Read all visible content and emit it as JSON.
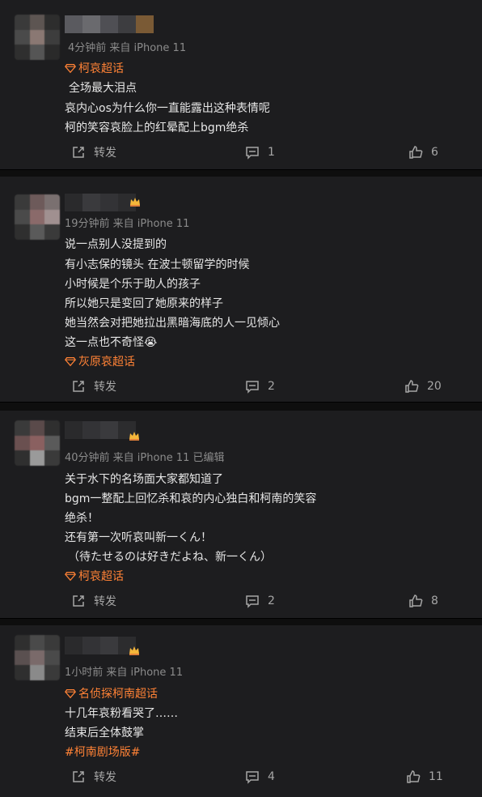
{
  "posts": [
    {
      "meta": "4分钟前 来自 iPhone 11",
      "tag": "柯哀超话",
      "lines": [
        "全场最大泪点",
        "哀内心os为什么你一直能露出这种表情呢",
        "柯的笑容哀脸上的红晕配上bgm绝杀"
      ],
      "repost_label": "转发",
      "comments": "1",
      "likes": "6"
    },
    {
      "meta": "19分钟前 来自 iPhone 11",
      "lines": [
        "说一点别人没提到的",
        "有小志保的镜头 在波士顿留学的时候",
        "小时候是个乐于助人的孩子",
        "所以她只是变回了她原来的样子",
        "她当然会对把她拉出黑暗海底的人一见倾心",
        "这一点也不奇怪"
      ],
      "emoji": "😭",
      "tag": "灰原哀超话",
      "repost_label": "转发",
      "comments": "2",
      "likes": "20"
    },
    {
      "meta": "40分钟前 来自 iPhone 11 已编辑",
      "lines": [
        "关于水下的名场面大家都知道了",
        "bgm一整配上回忆杀和哀的内心独白和柯南的笑容",
        "绝杀！",
        "还有第一次听哀叫新一くん！",
        "（待たせるのは好きだよね、新一くん）"
      ],
      "tag": "柯哀超话",
      "repost_label": "转发",
      "comments": "2",
      "likes": "8"
    },
    {
      "meta": "1小时前 来自 iPhone 11",
      "tag": "名侦探柯南超话",
      "lines": [
        "十几年哀粉看哭了……",
        "结束后全体鼓掌"
      ],
      "hashtag": "#柯南剧场版#",
      "repost_label": "转发",
      "comments": "4",
      "likes": "11"
    }
  ],
  "colors": {
    "accent": "#ff8236",
    "bg": "#1d1d1f",
    "muted": "#8b8b8b"
  }
}
